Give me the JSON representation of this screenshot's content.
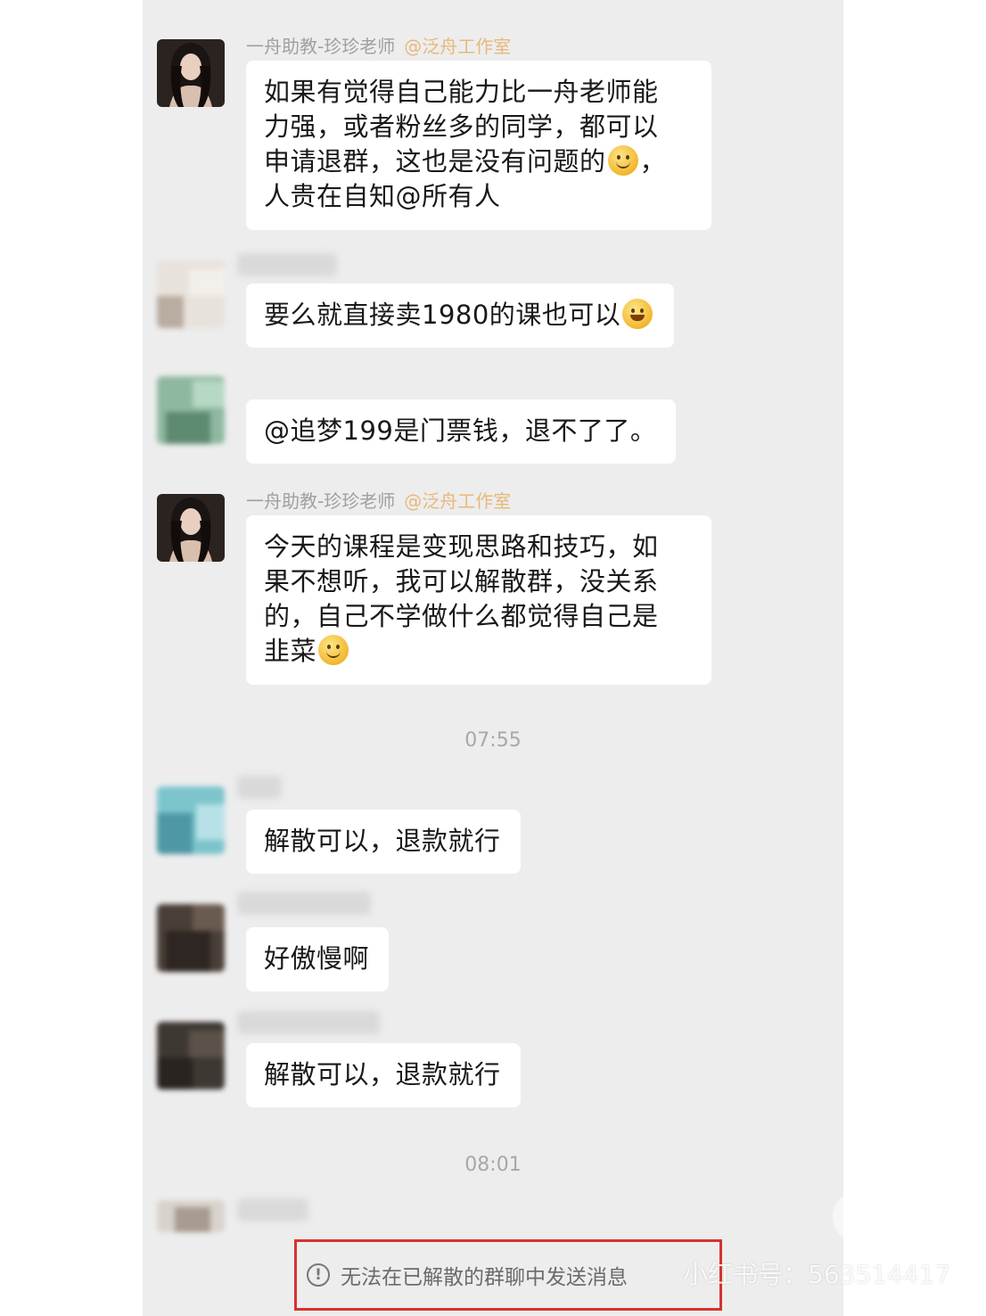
{
  "messages": [
    {
      "sender": "一舟助教-珍珍老师",
      "sender_tag": "@泛舟工作室",
      "lines": [
        "如果有觉得自己能力比一舟老师能",
        "力强，或者粉丝多的同学，都可以",
        "申请退群，这也是没有问题的",
        "，",
        "人贵在自知@所有人"
      ]
    },
    {
      "text": "要么就直接卖1980的课也可以"
    },
    {
      "text": "@追梦199是门票钱，退不了了。"
    },
    {
      "sender": "一舟助教-珍珍老师",
      "sender_tag": "@泛舟工作室",
      "lines": [
        "今天的课程是变现思路和技巧，如",
        "果不想听，我可以解散群，没关系",
        "的，自己不学做什么都觉得自己是",
        "韭菜"
      ]
    },
    {
      "text": "解散可以，退款就行"
    },
    {
      "text": "好傲慢啊"
    },
    {
      "text": "解散可以，退款就行"
    }
  ],
  "timestamps": [
    "07:55",
    "08:01"
  ],
  "emojis": {
    "smile": "smile-emoji",
    "laugh": "laugh-cry-emoji"
  },
  "notice": {
    "icon": "warning-circle-icon",
    "icon_glyph": "!",
    "text": "无法在已解散的群聊中发送消息"
  },
  "watermark": {
    "logo_text": "小红书",
    "id_text": "小红书号：563514417"
  },
  "colors": {
    "chat_bg": "#ededed",
    "bubble_bg": "#ffffff",
    "highlight_border": "#d6322f",
    "sender_tag": "#e8b87a"
  }
}
